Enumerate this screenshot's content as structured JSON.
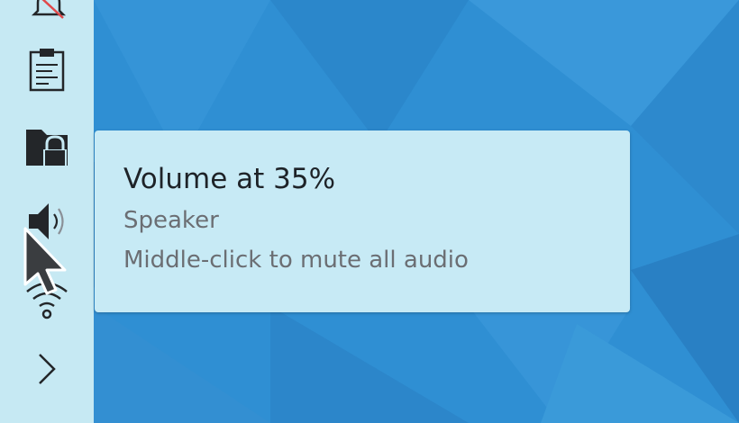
{
  "tray": {
    "icons": [
      "notifications-muted-icon",
      "clipboard-icon",
      "vault-lock-icon",
      "speaker-volume-icon",
      "wifi-icon",
      "expand-chevron-icon"
    ]
  },
  "tooltip": {
    "title": "Volume at 35%",
    "subtitle": "Speaker",
    "hint": "Middle-click to mute all audio"
  },
  "colors": {
    "panel_background": "#c6e9f3",
    "tooltip_background": "#c7eaf5",
    "wallpaper": "#2f8fd3",
    "icon": "#232629",
    "mute_slash": "#e0494b"
  }
}
